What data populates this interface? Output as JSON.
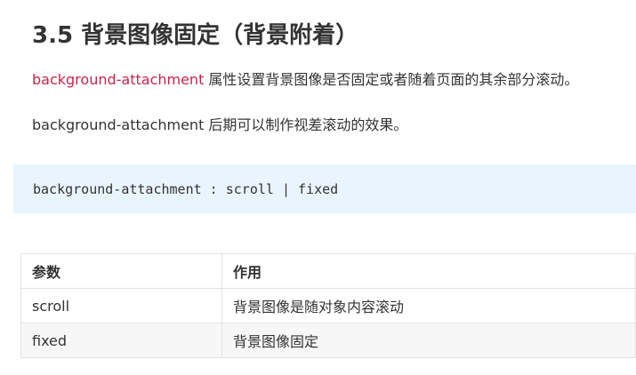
{
  "section": {
    "title": "3.5 背景图像固定（背景附着）"
  },
  "paragraphs": {
    "p1_prop": "background-attachment",
    "p1_text": " 属性设置背景图像是否固定或者随着页面的其余部分滚动。",
    "p2_text": "background-attachment 后期可以制作视差滚动的效果。"
  },
  "code": {
    "text": "background-attachment : scroll | fixed"
  },
  "table": {
    "headers": [
      "参数",
      "作用"
    ],
    "rows": [
      [
        "scroll",
        "背景图像是随对象内容滚动"
      ],
      [
        "fixed",
        "背景图像固定"
      ]
    ]
  },
  "colors": {
    "prop_highlight": "#c7254e",
    "code_bg": "#eaf4fe",
    "text": "#333333"
  }
}
